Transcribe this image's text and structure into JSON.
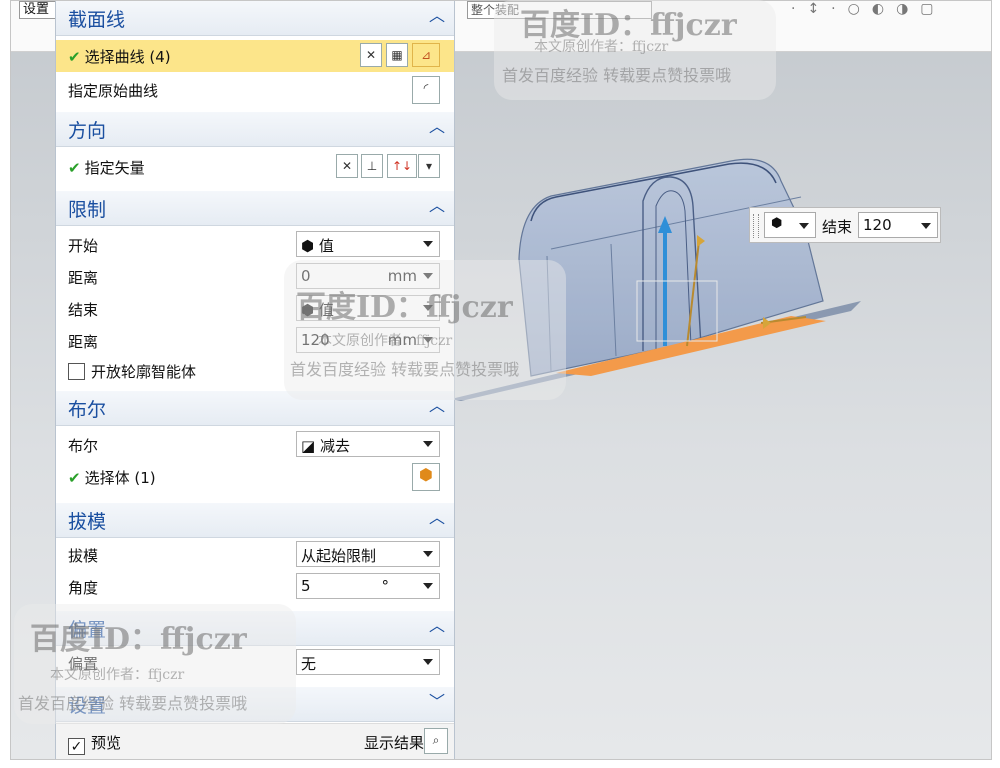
{
  "topbar": {
    "input_left": "设置",
    "input_mid": "整个装配"
  },
  "sections": {
    "section_curve": {
      "title": "截面线",
      "select_curve": "选择曲线 (4)",
      "specify_curve": "指定原始曲线"
    },
    "direction": {
      "title": "方向",
      "specify_vector": "指定矢量"
    },
    "limits": {
      "title": "限制",
      "start_label": "开始",
      "start_value": "值",
      "distance1_label": "距离",
      "distance1_value": "0",
      "distance1_unit": "mm",
      "end_label": "结束",
      "end_value": "值",
      "distance2_label": "距离",
      "distance2_value": "120",
      "distance2_unit": "mm",
      "open_profile": "开放轮廓智能体"
    },
    "boolean": {
      "title": "布尔",
      "boolean_label": "布尔",
      "boolean_value": "减去",
      "select_body": "选择体 (1)"
    },
    "draft": {
      "title": "拔模",
      "draft_label": "拔模",
      "draft_value": "从起始限制",
      "angle_label": "角度",
      "angle_value": "5",
      "angle_unit": "°"
    },
    "offset": {
      "title": "偏置",
      "offset_label": "偏置",
      "offset_value": "无"
    },
    "settings": {
      "title": "设置"
    }
  },
  "footer": {
    "preview": "预览",
    "show_result": "显示结果"
  },
  "popup": {
    "label": "结束",
    "value": "120"
  },
  "watermarks": {
    "id_text": "百度ID：ffjczr",
    "author": "本文原创作者：ffjczr",
    "slogan": "首发百度经验 转载要点赞投票哦"
  }
}
